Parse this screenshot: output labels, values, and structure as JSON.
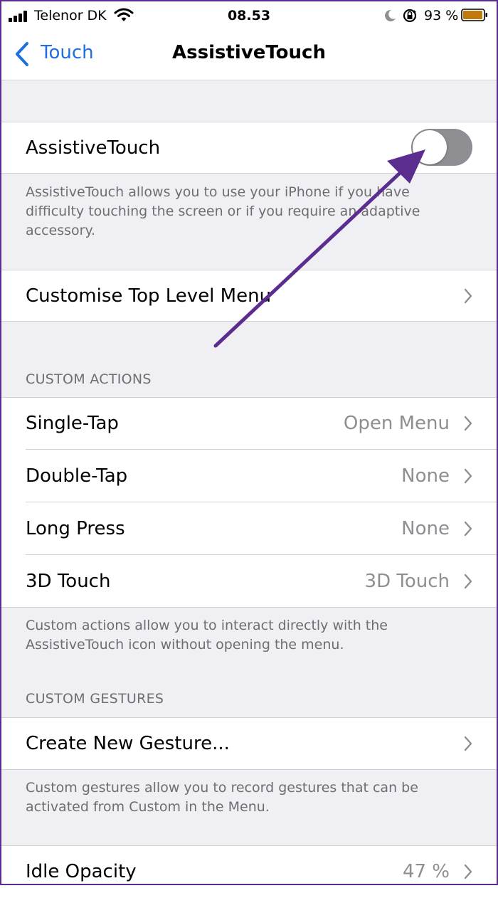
{
  "status_bar": {
    "carrier": "Telenor DK",
    "time": "08.53",
    "battery_percent": "93 %",
    "icons": [
      "signal-icon",
      "wifi-icon",
      "moon-icon",
      "rotation-lock-icon",
      "battery-icon"
    ]
  },
  "nav": {
    "back_label": "Touch",
    "title": "AssistiveTouch"
  },
  "main_toggle": {
    "label": "AssistiveTouch",
    "enabled": false
  },
  "main_footer": "AssistiveTouch allows you to use your iPhone if you have difficulty touching the screen or if you require an adaptive accessory.",
  "customise_menu": {
    "label": "Customise Top Level Menu"
  },
  "custom_actions": {
    "header": "CUSTOM ACTIONS",
    "rows": [
      {
        "label": "Single-Tap",
        "value": "Open Menu"
      },
      {
        "label": "Double-Tap",
        "value": "None"
      },
      {
        "label": "Long Press",
        "value": "None"
      },
      {
        "label": "3D Touch",
        "value": "3D Touch"
      }
    ],
    "footer": "Custom actions allow you to interact directly with the AssistiveTouch icon without opening the menu."
  },
  "custom_gestures": {
    "header": "CUSTOM GESTURES",
    "row_label": "Create New Gesture...",
    "footer": "Custom gestures allow you to record gestures that can be activated from Custom in the Menu."
  },
  "idle_opacity": {
    "label": "Idle Opacity",
    "value": "47 %"
  },
  "colors": {
    "accent": "#1f6fe0",
    "annotation_arrow": "#5b2d8e",
    "toggle_off": "#8e8e93",
    "group_background": "#efeff4"
  }
}
